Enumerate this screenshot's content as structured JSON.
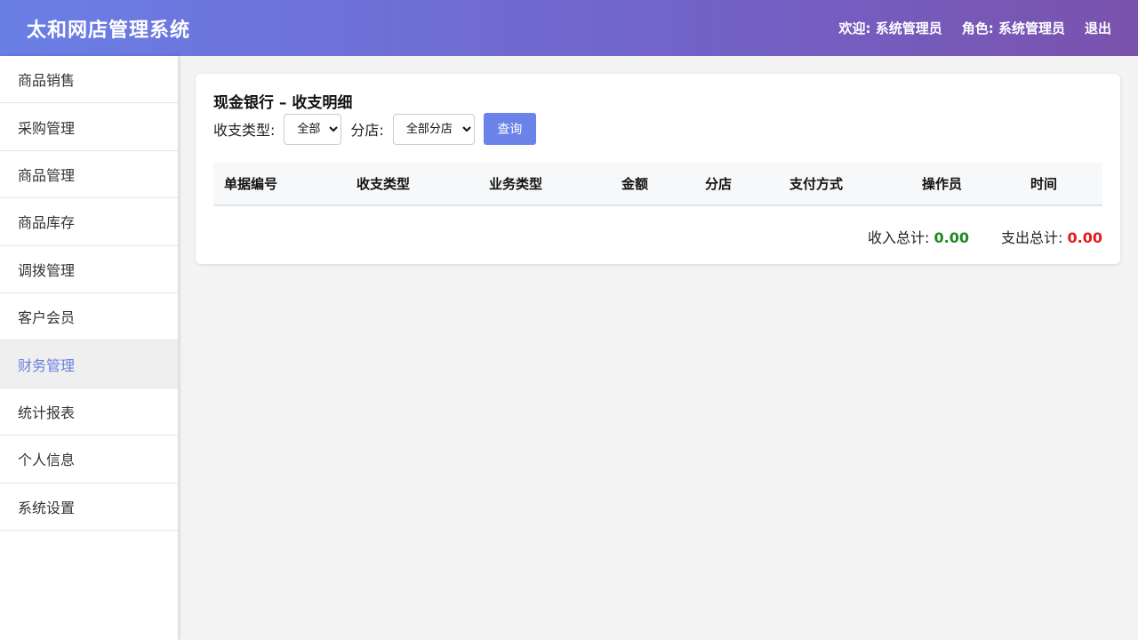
{
  "header": {
    "title": "太和网店管理系统",
    "welcome_label": "欢迎:",
    "welcome_user": "系统管理员",
    "role_label": "角色:",
    "role_value": "系统管理员",
    "logout_label": "退出"
  },
  "sidebar": {
    "items": [
      {
        "label": "商品销售"
      },
      {
        "label": "采购管理"
      },
      {
        "label": "商品管理"
      },
      {
        "label": "商品库存"
      },
      {
        "label": "调拨管理"
      },
      {
        "label": "客户会员"
      },
      {
        "label": "财务管理",
        "active": true
      },
      {
        "label": "统计报表"
      },
      {
        "label": "个人信息"
      },
      {
        "label": "系统设置"
      }
    ]
  },
  "main": {
    "title": "现金银行 – 收支明细",
    "filters": {
      "type_label": "收支类型:",
      "type_value": "全部",
      "branch_label": "分店:",
      "branch_value": "全部分店",
      "query_label": "查询"
    },
    "table": {
      "columns": [
        "单据编号",
        "收支类型",
        "业务类型",
        "金额",
        "分店",
        "支付方式",
        "操作员",
        "时间"
      ],
      "rows": []
    },
    "totals": {
      "income_label": "收入总计:",
      "income_value": "0.00",
      "expense_label": "支出总计:",
      "expense_value": "0.00"
    }
  },
  "colors": {
    "accent": "#6b82e8",
    "income": "#1c8a1c",
    "expense": "#e21b1b"
  }
}
